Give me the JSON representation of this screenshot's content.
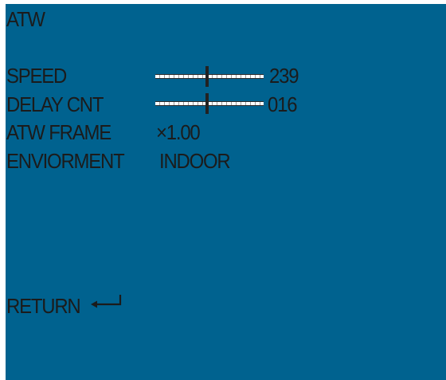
{
  "menu": {
    "title": "ATW",
    "items": [
      {
        "label": "SPEED",
        "type": "slider",
        "value": "239",
        "slider_fraction": 0.48
      },
      {
        "label": "DELAY CNT",
        "type": "slider",
        "value": "016",
        "slider_fraction": 0.48
      },
      {
        "label": "ATW FRAME",
        "type": "text",
        "value": "×1.00"
      },
      {
        "label": "ENVIORMENT",
        "type": "text",
        "value": "INDOOR"
      }
    ],
    "return_label": "RETURN",
    "return_icon": "enter-arrow-icon"
  },
  "colors": {
    "background": "#00628f",
    "text": "#1b1b1b"
  }
}
